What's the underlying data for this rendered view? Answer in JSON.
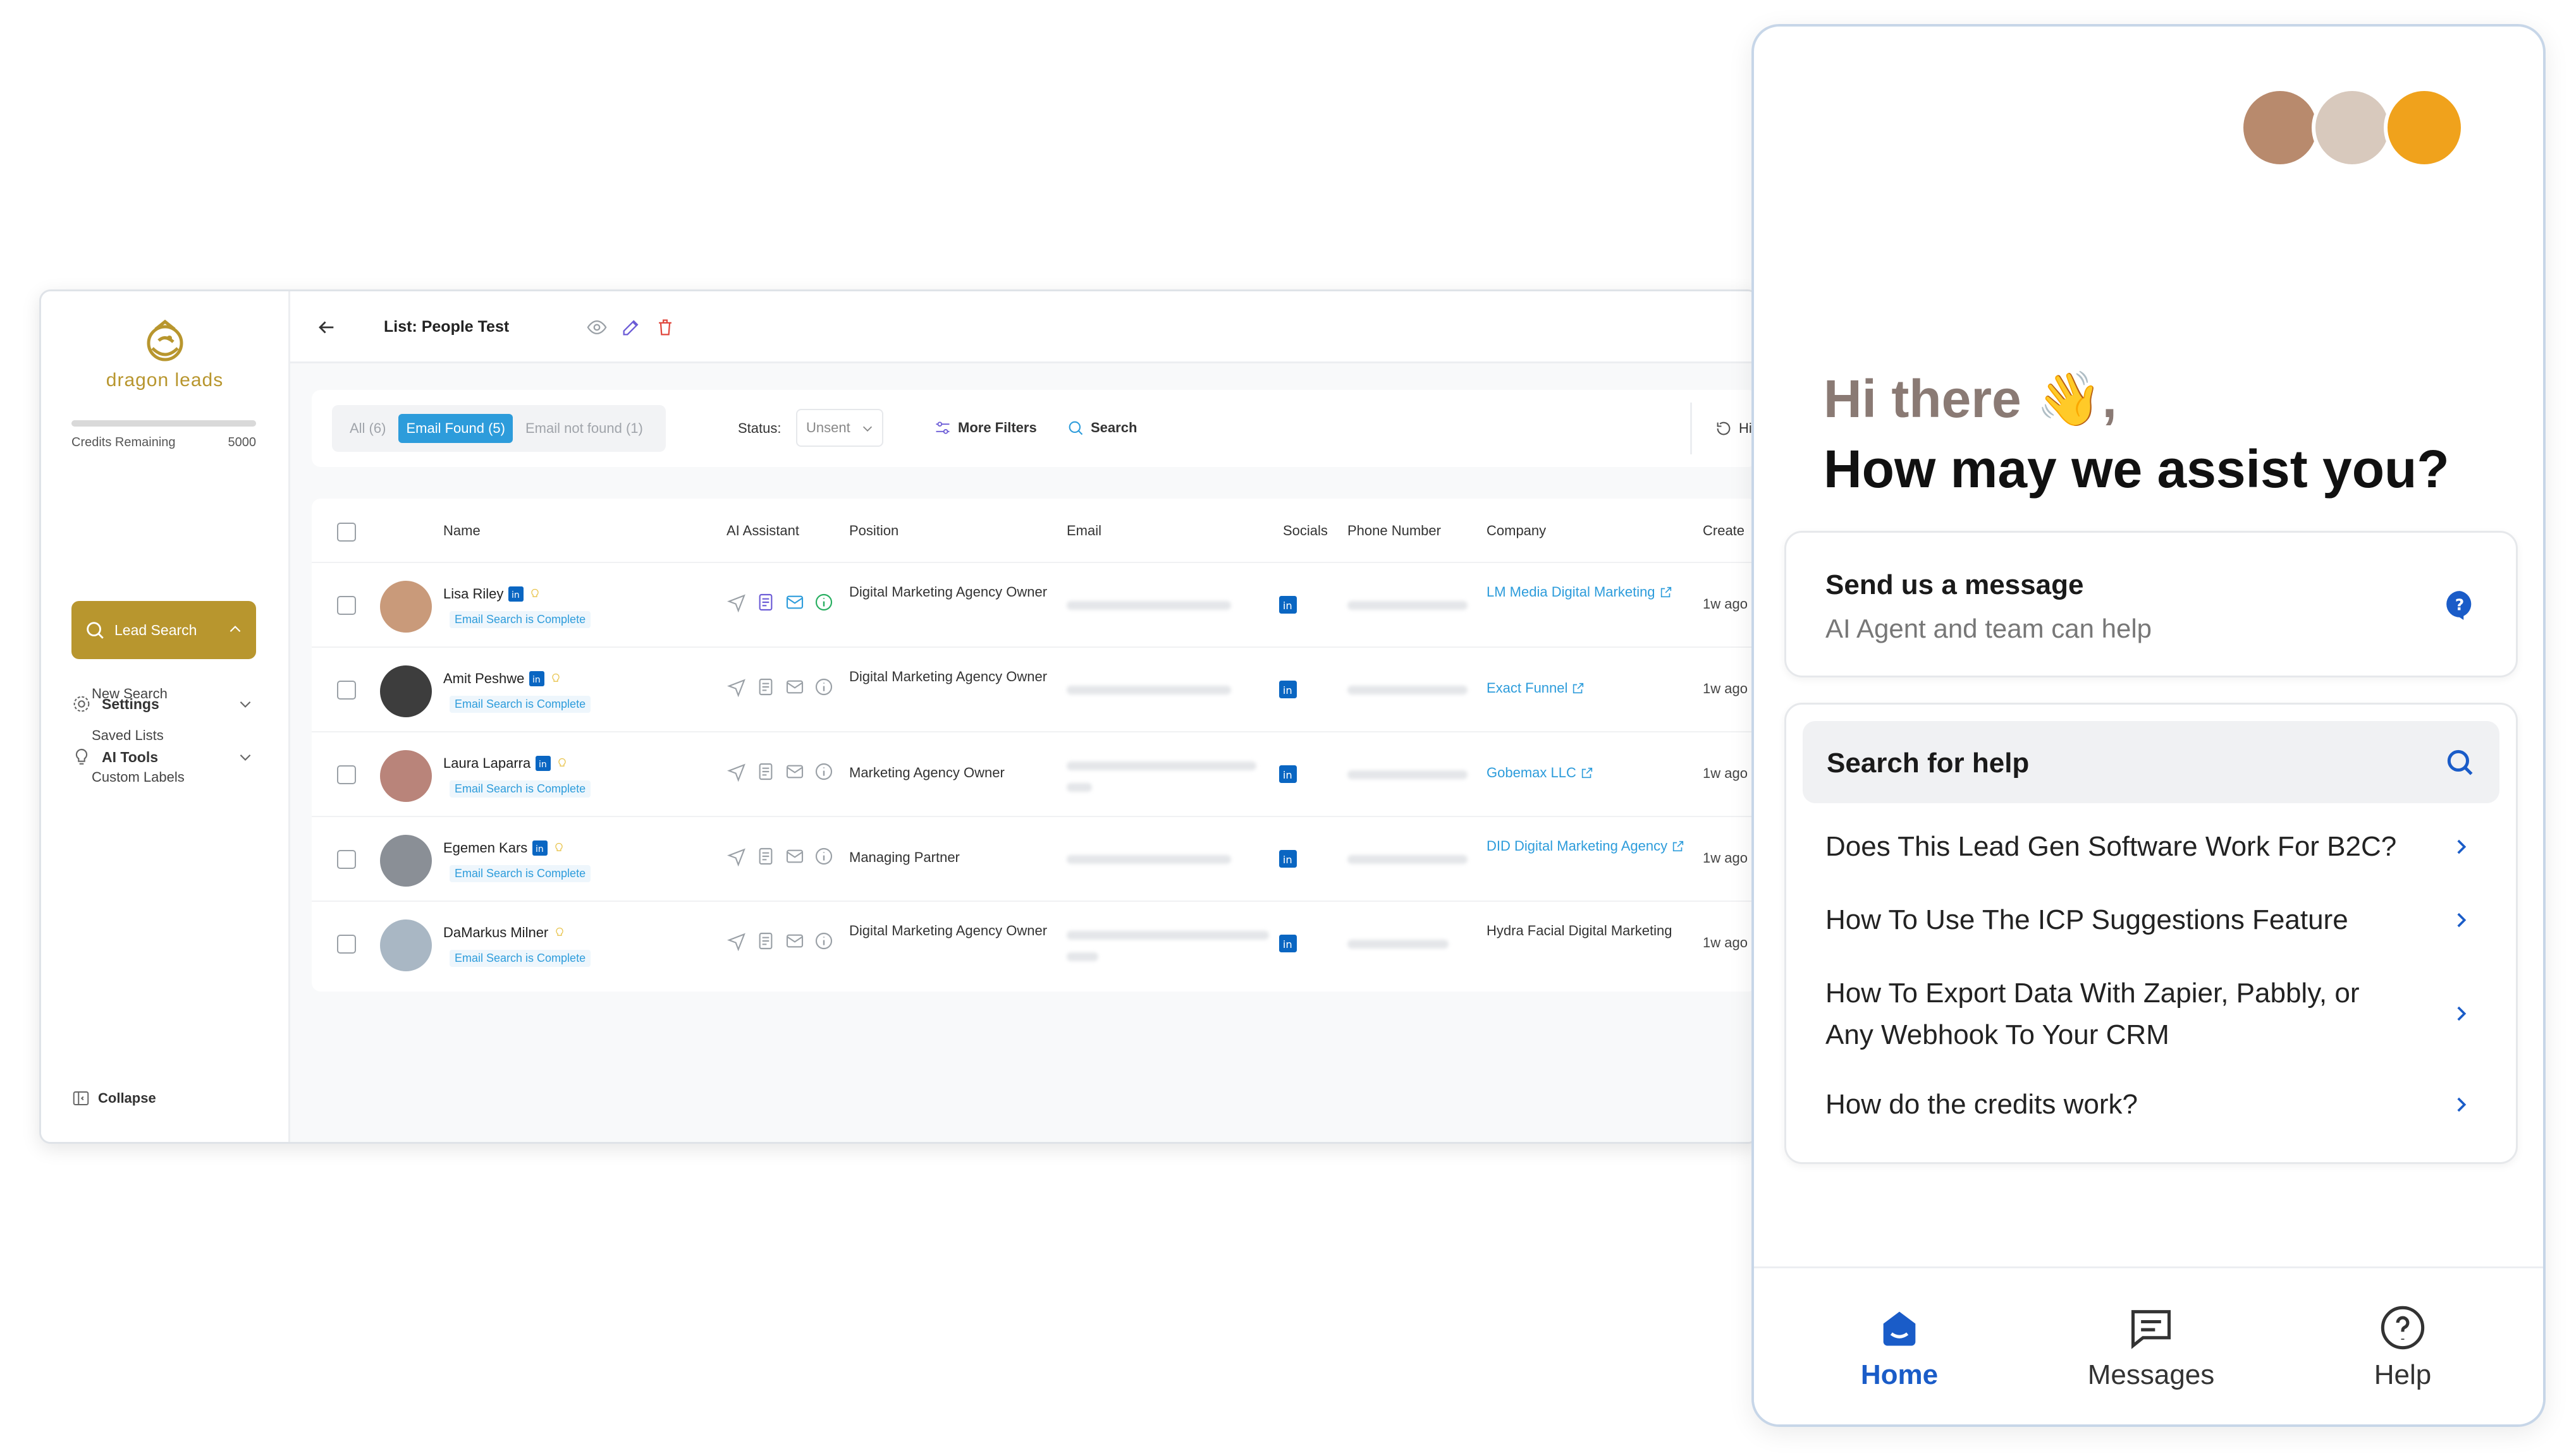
{
  "app": {
    "brand": "dragon leads",
    "credits_label": "Credits Remaining",
    "credits_value": "5000",
    "nav": {
      "settings": "Settings",
      "ai_tools": "AI Tools",
      "lead_search": "Lead Search",
      "sub": [
        "New Search",
        "Saved Lists",
        "Custom Labels"
      ],
      "collapse": "Collapse"
    },
    "list_title": "List: People Test",
    "tabs": [
      {
        "label": "All (6)",
        "active": false
      },
      {
        "label": "Email Found (5)",
        "active": true
      },
      {
        "label": "Email not found (1)",
        "active": false
      }
    ],
    "status_label": "Status:",
    "status_value": "Unsent",
    "more_filters": "More Filters",
    "search": "Search",
    "history": "History",
    "columns": [
      "Name",
      "AI Assistant",
      "Position",
      "Email",
      "Socials",
      "Phone Number",
      "Company",
      "Create"
    ],
    "rows": [
      {
        "name": "Lisa Riley",
        "tag": "Email Search is Complete",
        "position": "Digital Marketing Agency Owner",
        "company": "LM Media Digital Marketing",
        "company_link": true,
        "created": "1w ago"
      },
      {
        "name": "Amit Peshwe",
        "tag": "Email Search is Complete",
        "position": "Digital Marketing Agency Owner",
        "company": "Exact Funnel",
        "company_link": true,
        "created": "1w ago"
      },
      {
        "name": "Laura Laparra",
        "tag": "Email Search is Complete",
        "position": "Marketing Agency Owner",
        "company": "Gobemax LLC",
        "company_link": true,
        "created": "1w ago"
      },
      {
        "name": "Egemen Kars",
        "tag": "Email Search is Complete",
        "position": "Managing Partner",
        "company": "DID Digital Marketing Agency",
        "company_link": true,
        "created": "1w ago"
      },
      {
        "name": "DaMarkus Milner",
        "tag": "Email Search is Complete",
        "position": "Digital Marketing Agency Owner",
        "company": "Hydra Facial Digital Marketing",
        "company_link": false,
        "created": "1w ago"
      }
    ]
  },
  "widget": {
    "greeting_line1": "Hi there 👋,",
    "greeting_line2": "How may we assist you?",
    "send_title": "Send us a message",
    "send_sub": "AI Agent and team can help",
    "search_help": "Search for help",
    "faqs": [
      "Does This Lead Gen Software Work For B2C?",
      "How To Use The ICP Suggestions Feature",
      "How To Export Data With Zapier, Pabbly, or Any Webhook To Your CRM",
      "How do the credits work?"
    ],
    "bottom_nav": [
      "Home",
      "Messages",
      "Help"
    ],
    "accent": "#1a5cc8"
  },
  "colors": {
    "brand_gold": "#b8962e",
    "link_blue": "#2d9cdb"
  }
}
